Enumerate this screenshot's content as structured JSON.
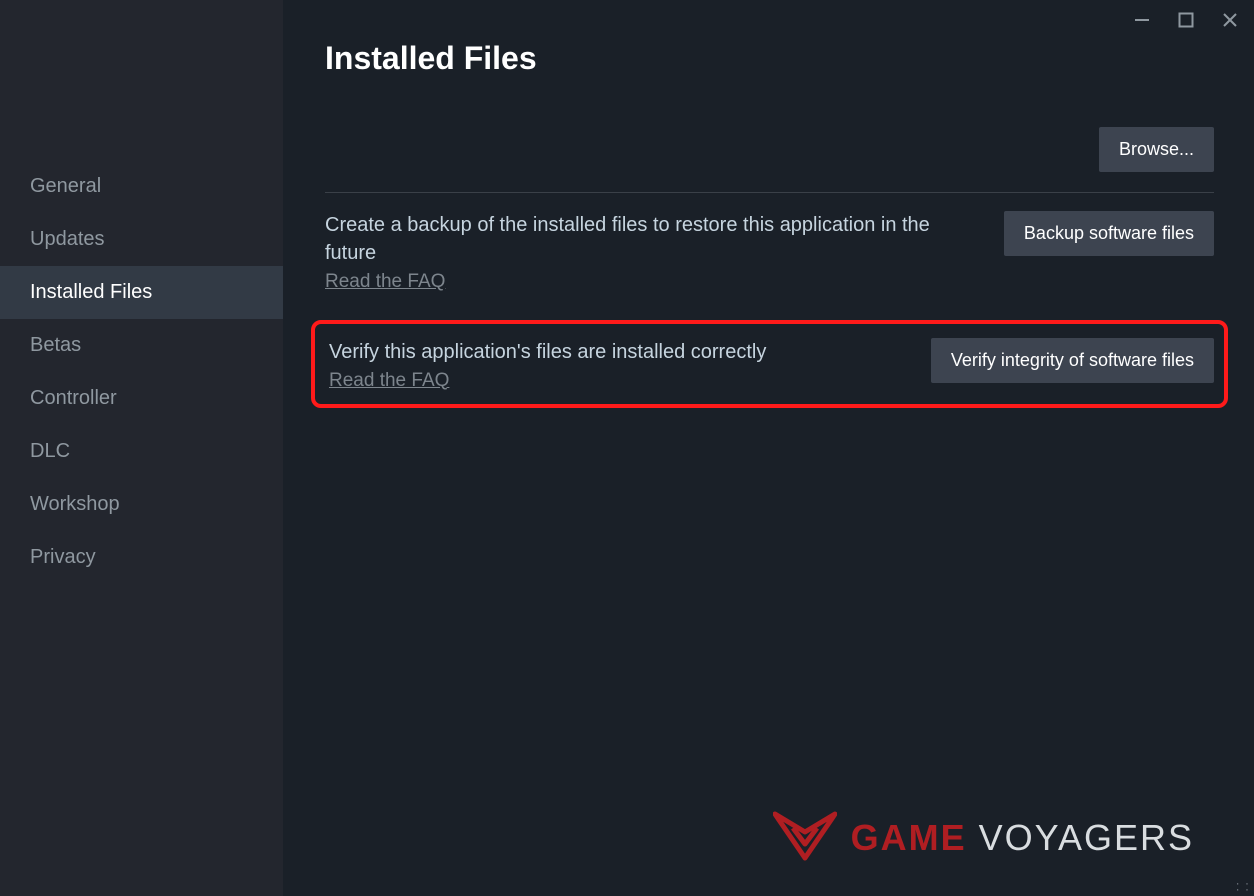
{
  "title": "Installed Files",
  "sidebar": {
    "items": [
      {
        "label": "General",
        "active": false
      },
      {
        "label": "Updates",
        "active": false
      },
      {
        "label": "Installed Files",
        "active": true
      },
      {
        "label": "Betas",
        "active": false
      },
      {
        "label": "Controller",
        "active": false
      },
      {
        "label": "DLC",
        "active": false
      },
      {
        "label": "Workshop",
        "active": false
      },
      {
        "label": "Privacy",
        "active": false
      }
    ]
  },
  "buttons": {
    "browse": "Browse...",
    "backup": "Backup software files",
    "verify": "Verify integrity of software files"
  },
  "rows": {
    "backup_desc": "Create a backup of the installed files to restore this application in the future",
    "verify_desc": "Verify this application's files are installed correctly",
    "faq": "Read the FAQ"
  },
  "watermark": {
    "game": "GAME",
    "voyagers": "VOYAGERS"
  }
}
